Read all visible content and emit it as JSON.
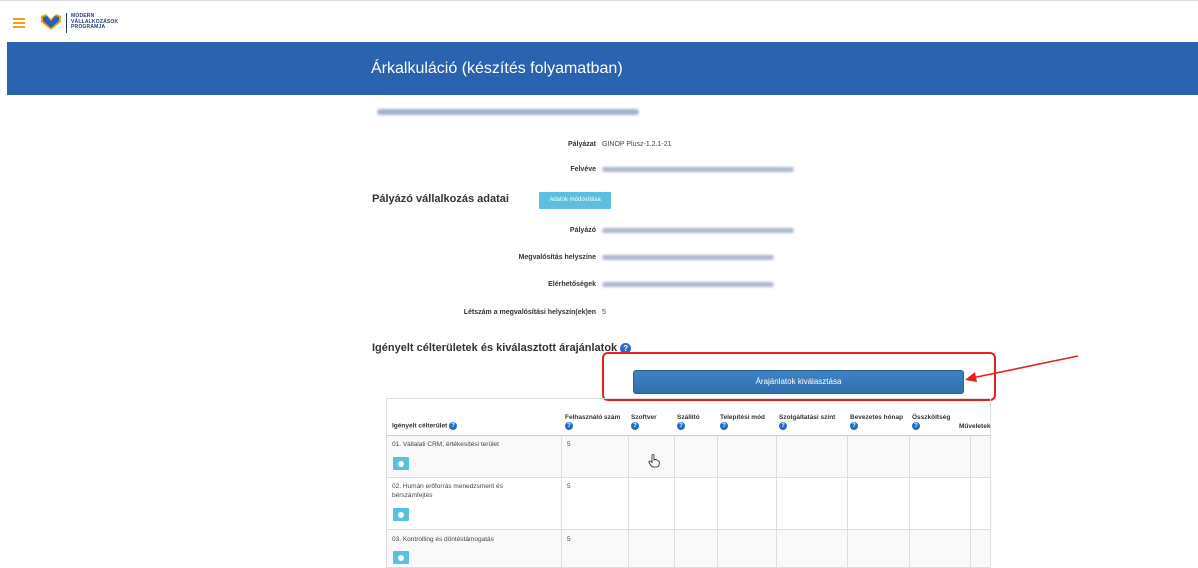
{
  "header": {
    "logo_lines": [
      "MODERN",
      "VÁLLALKOZÁSOK",
      "PROGRAMJA"
    ]
  },
  "banner": {
    "title": "Árkalkuláció (készítés folyamatban)"
  },
  "summary": {
    "palyazat_label": "Pályázat",
    "palyazat_value": "GINOP Plusz-1.2.1-21",
    "felveve_label": "Felvéve"
  },
  "company_section": {
    "title": "Pályázó vállalkozás adatai",
    "edit_button": "Adatok módosítása",
    "fields": {
      "palyazo_label": "Pályázó",
      "helyszin_label": "Megvalósítás helyszíne",
      "elerhetosegek_label": "Elérhetőségek",
      "letszam_label": "Létszám a megvalósítási helyszín(ek)en",
      "letszam_value": "5"
    }
  },
  "targets_section": {
    "title": "Igényelt célterületek és kiválasztott árajánlatok",
    "select_button": "Árajánlatok kiválasztása"
  },
  "table": {
    "headers": {
      "celterulet": "Igényelt célterület",
      "felhasznalo": "Felhasználó szám",
      "szoftver": "Szoftver",
      "szallito": "Szállító",
      "telepitesi": "Telepítési mód",
      "szolgaltatasi": "Szolgáltatási szint",
      "bevezetes": "Bevezetés hónap",
      "osszkoltseg": "Összköltség",
      "muveletek": "Műveletek"
    },
    "rows": [
      {
        "name": "01. Vállalati CRM, értékesítési terület",
        "users": "5"
      },
      {
        "name": "02. Humán erőforrás menedzsment és bérszámfejtés",
        "users": "5"
      },
      {
        "name": "03. Kontrolling és döntéstámogatás",
        "users": "5"
      }
    ]
  },
  "colors": {
    "banner": "#2a62b0",
    "accent_button": "#5bc0de",
    "primary_button": "#3f83c4",
    "highlight": "#e4211c",
    "menu_icon": "#f0a21b"
  }
}
